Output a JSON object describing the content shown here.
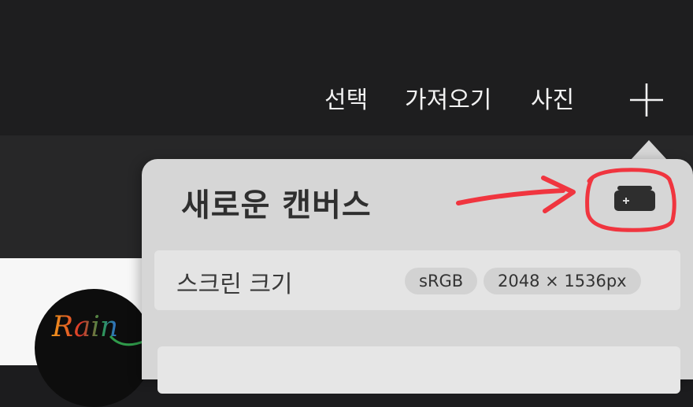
{
  "nav": {
    "select_label": "선택",
    "import_label": "가져오기",
    "photo_label": "사진",
    "add_icon": "plus-icon"
  },
  "popover": {
    "title": "새로운 캔버스",
    "new_canvas_icon": "new-canvas-icon",
    "rows": [
      {
        "label": "스크린 크기",
        "color_profile": "sRGB",
        "size": "2048 × 1536px"
      }
    ]
  },
  "gallery": {
    "thumb_text": "Rain"
  },
  "annotation": {
    "color": "#f0353f"
  }
}
